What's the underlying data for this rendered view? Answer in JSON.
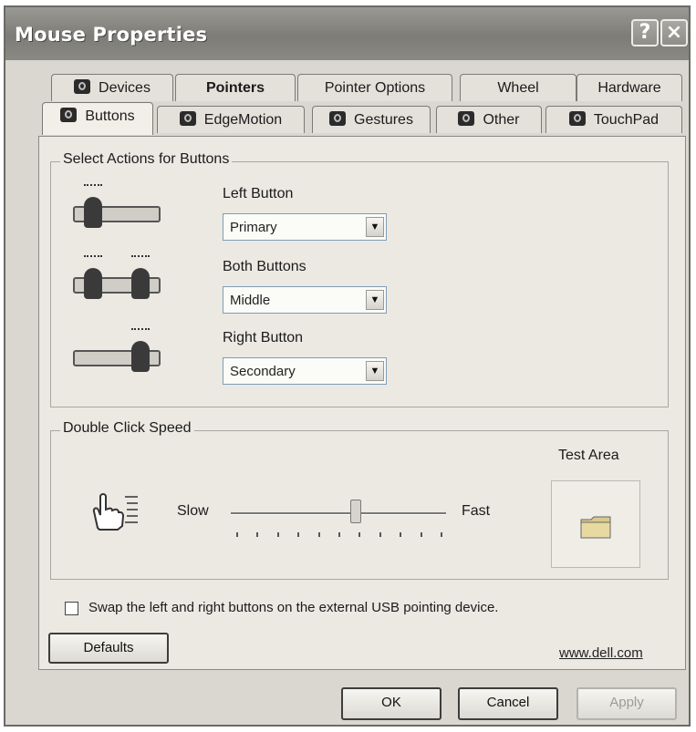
{
  "window": {
    "title": "Mouse Properties",
    "help_label": "?",
    "close_label": "×"
  },
  "tabs": {
    "row1": [
      "Devices",
      "Pointers",
      "Pointer Options",
      "Wheel",
      "Hardware"
    ],
    "row2": [
      "Buttons",
      "EdgeMotion",
      "Gestures",
      "Other",
      "TouchPad"
    ],
    "active": "Buttons"
  },
  "actions": {
    "group_title": "Select Actions for Buttons",
    "left": {
      "label": "Left Button",
      "value": "Primary"
    },
    "both": {
      "label": "Both Buttons",
      "value": "Middle"
    },
    "right": {
      "label": "Right Button",
      "value": "Secondary"
    }
  },
  "speed": {
    "group_title": "Double Click Speed",
    "slow_label": "Slow",
    "fast_label": "Fast",
    "slider_value": 0.58,
    "tick_count": 11,
    "test_area_label": "Test Area"
  },
  "swap": {
    "label": "Swap the left and right buttons on the external USB pointing device.",
    "checked": false
  },
  "defaults_label": "Defaults",
  "link_text": "www.dell.com",
  "footer": {
    "ok": "OK",
    "cancel": "Cancel",
    "apply": "Apply"
  }
}
